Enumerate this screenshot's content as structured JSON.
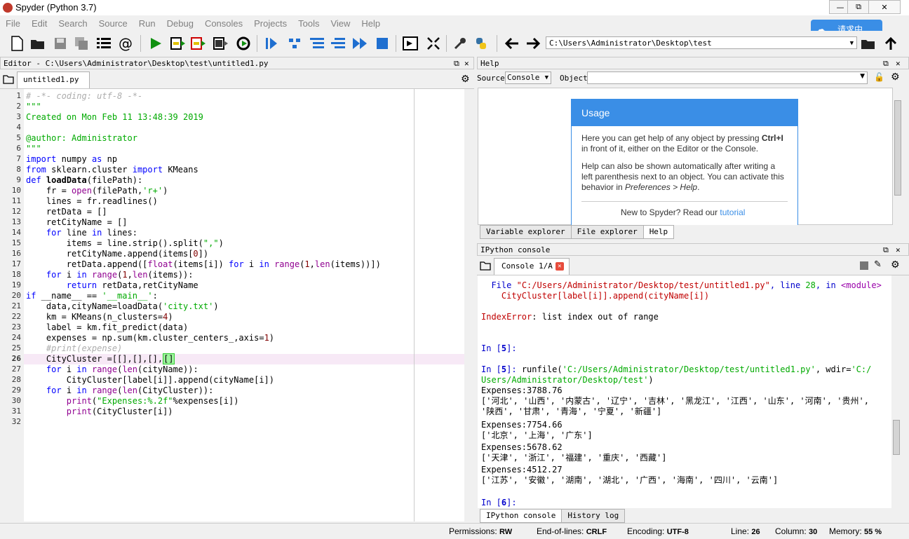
{
  "window": {
    "title": "Spyder (Python 3.7)",
    "controls": {
      "minimize": "—",
      "restore": "⧉",
      "close": "✕"
    }
  },
  "menu": [
    "File",
    "Edit",
    "Search",
    "Source",
    "Run",
    "Debug",
    "Consoles",
    "Projects",
    "Tools",
    "View",
    "Help"
  ],
  "cloud_badge": {
    "label": "请求中..."
  },
  "toolbar": {
    "path": "C:\\Users\\Administrator\\Desktop\\test"
  },
  "editor": {
    "header": "Editor - C:\\Users\\Administrator\\Desktop\\test\\untitled1.py",
    "tab": "untitled1.py",
    "line_numbers": [
      "1",
      "2",
      "3",
      "4",
      "5",
      "6",
      "7",
      "8",
      "9",
      "10",
      "11",
      "12",
      "13",
      "14",
      "15",
      "16",
      "17",
      "18",
      "19",
      "20",
      "21",
      "22",
      "23",
      "24",
      "25",
      "26",
      "27",
      "28",
      "29",
      "30",
      "31",
      "32"
    ],
    "current_line": "26"
  },
  "help": {
    "header": "Help",
    "source_label": "Source",
    "source_value": "Console",
    "object_label": "Object",
    "usage_title": "Usage",
    "usage_p1a": "Here you can get help of any object by pressing ",
    "usage_p1b": "Ctrl+I",
    "usage_p1c": " in front of it, either on the Editor or the Console.",
    "usage_p2a": "Help can also be shown automatically after writing a left parenthesis next to an object. You can activate this behavior in ",
    "usage_p2b": "Preferences > Help",
    "usage_p2c": ".",
    "usage_foot": "New to Spyder? Read our ",
    "usage_link": "tutorial",
    "tabs": [
      "Variable explorer",
      "File explorer",
      "Help"
    ]
  },
  "console": {
    "header": "IPython console",
    "tab": "Console 1/A",
    "tabs": [
      "IPython console",
      "History log"
    ]
  },
  "statusbar": {
    "permissions_label": "Permissions:",
    "permissions": "RW",
    "eol_label": "End-of-lines:",
    "eol": "CRLF",
    "encoding_label": "Encoding:",
    "encoding": "UTF-8",
    "line_label": "Line:",
    "line": "26",
    "column_label": "Column:",
    "column": "30",
    "memory_label": "Memory:",
    "memory": "55 %"
  }
}
